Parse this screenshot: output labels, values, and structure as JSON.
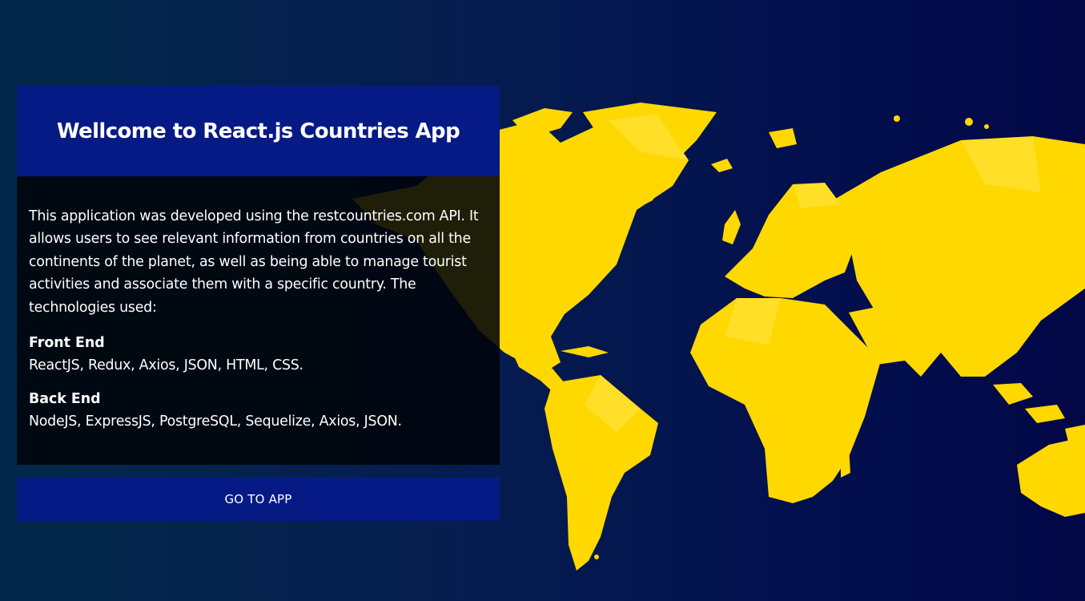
{
  "colors": {
    "background_left": "#03294a",
    "background_right": "#020746",
    "accent_blue": "#061a85",
    "map_yellow": "#ffd800",
    "panel_body": "#00040a",
    "text": "#ffffff"
  },
  "background": {
    "map_icon": "world-map-icon"
  },
  "panel": {
    "title": "Wellcome to React.js Countries App",
    "description": "This application was developed using the restcountries.com API. It allows users to see relevant information from countries on all the continents of the planet, as well as being able to manage tourist activities and associate them with a specific country. The technologies used:",
    "front_end": {
      "heading": "Front End",
      "list": "ReactJS, Redux, Axios, JSON, HTML, CSS."
    },
    "back_end": {
      "heading": "Back End",
      "list": "NodeJS, ExpressJS, PostgreSQL, Sequelize, Axios, JSON."
    }
  },
  "cta": {
    "label": "GO TO APP"
  }
}
